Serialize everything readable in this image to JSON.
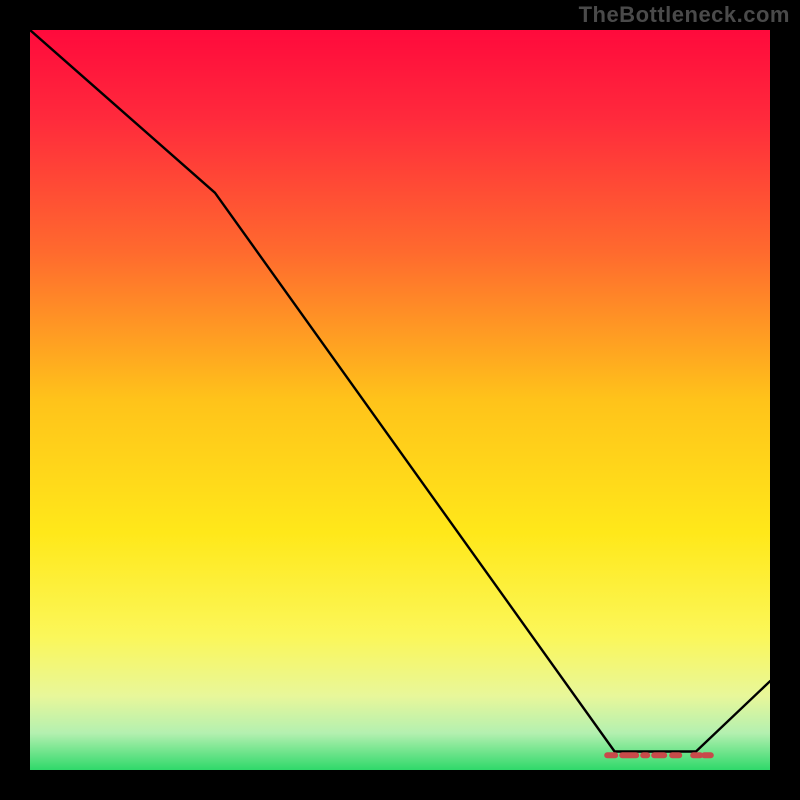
{
  "watermark": "TheBottleneck.com",
  "chart_data": {
    "type": "line",
    "title": "",
    "xlabel": "",
    "ylabel": "",
    "xlim": [
      0,
      100
    ],
    "ylim": [
      0,
      100
    ],
    "grid": false,
    "legend": false,
    "series": [
      {
        "name": "bottleneck-curve",
        "x": [
          0,
          25,
          79,
          90,
          100
        ],
        "values": [
          100,
          78,
          2.5,
          2.5,
          12
        ]
      }
    ],
    "markers": {
      "name": "highlight-band",
      "x_range": [
        78,
        92
      ],
      "y": 2.0,
      "color": "#c84a4a"
    },
    "background_gradient": {
      "stops": [
        {
          "offset": 0.0,
          "color": "#ff0a3c"
        },
        {
          "offset": 0.12,
          "color": "#ff2a3c"
        },
        {
          "offset": 0.3,
          "color": "#ff6a2e"
        },
        {
          "offset": 0.5,
          "color": "#ffc31a"
        },
        {
          "offset": 0.68,
          "color": "#ffe81a"
        },
        {
          "offset": 0.82,
          "color": "#fbf75a"
        },
        {
          "offset": 0.9,
          "color": "#e8f79a"
        },
        {
          "offset": 0.95,
          "color": "#b4f0b0"
        },
        {
          "offset": 1.0,
          "color": "#2fd96a"
        }
      ]
    }
  }
}
